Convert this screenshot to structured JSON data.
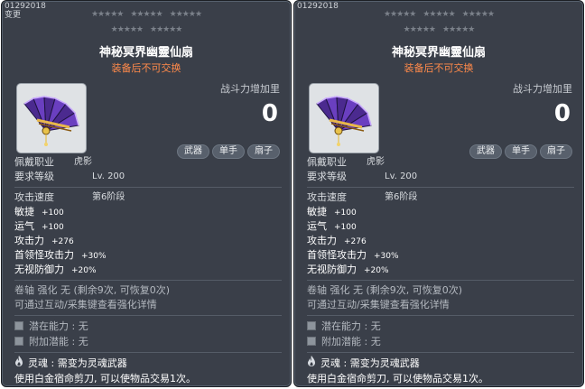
{
  "cards": [
    {
      "code": "01292018",
      "changed_label": "变更",
      "title": "神秘冥界幽靈仙扇",
      "untradable": "装备后不可交换",
      "power_label": "战斗力增加里",
      "power_value": "0",
      "tags": [
        "武器",
        "单手",
        "扇子"
      ],
      "job_label": "佩戴职业",
      "job_value": "虎影",
      "req_label": "要求等级",
      "req_value": "Lv. 200",
      "speed_label": "攻击速度",
      "speed_value": "第6阶段",
      "stats": [
        {
          "label": "敏捷",
          "value": "+100"
        },
        {
          "label": "运气",
          "value": "+100"
        },
        {
          "label": "攻击力",
          "value": "+276"
        },
        {
          "label": "首领怪攻击力",
          "value": "+30%"
        },
        {
          "label": "无视防御力",
          "value": "+20%"
        }
      ],
      "scroll_line": "卷轴 强化 无  (剩余9次, 可恢复0次)",
      "enhance_line": "可通过互动/采集键查看强化详情",
      "potential_label": "潜在能力",
      "potential_value": "无",
      "bonus_label": "附加潜能",
      "bonus_value": "无",
      "soul_label": "灵魂",
      "soul_value": "需变为灵魂武器",
      "scissors_line": "使用白金宿命剪刀, 可以使物品交易1次。"
    },
    {
      "code": "01292018",
      "changed_label": "",
      "title": "神秘冥界幽靈仙扇",
      "untradable": "装备后不可交换",
      "power_label": "战斗力增加里",
      "power_value": "0",
      "tags": [
        "武器",
        "单手",
        "扇子"
      ],
      "job_label": "佩戴职业",
      "job_value": "虎影",
      "req_label": "要求等级",
      "req_value": "Lv. 200",
      "speed_label": "攻击速度",
      "speed_value": "第6阶段",
      "stats": [
        {
          "label": "敏捷",
          "value": "+100"
        },
        {
          "label": "运气",
          "value": "+100"
        },
        {
          "label": "攻击力",
          "value": "+276"
        },
        {
          "label": "首领怪攻击力",
          "value": "+30%"
        },
        {
          "label": "无视防御力",
          "value": "+20%"
        }
      ],
      "scroll_line": "卷轴 强化 无  (剩余9次, 可恢复0次)",
      "enhance_line": "可通过互动/采集键查看强化详情",
      "potential_label": "潜在能力",
      "potential_value": "无",
      "bonus_label": "附加潜能",
      "bonus_value": "无",
      "soul_label": "灵魂",
      "soul_value": "需变为灵魂武器",
      "scissors_line": "使用白金宿命剪刀, 可以使物品交易1次。"
    }
  ],
  "icons": {
    "item": "fan-weapon-icon",
    "star": "star-icon",
    "potential": "potential-slot-icon",
    "soul": "soul-flame-icon"
  },
  "colors": {
    "card_bg": "#3a3f49",
    "untradable": "#ff8a4a",
    "title": "#ffffff"
  }
}
